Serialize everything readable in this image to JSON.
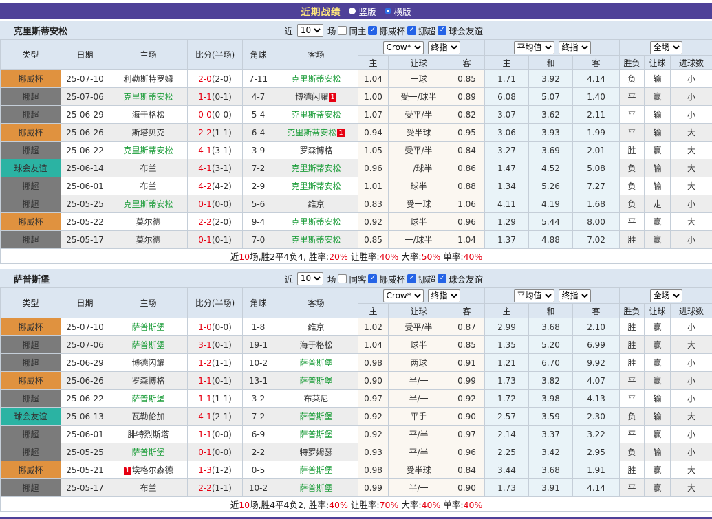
{
  "topbar": {
    "title": "近期战绩",
    "vertical": "竖版",
    "horizontal": "横版",
    "selected": "横版"
  },
  "filter": {
    "near": "近",
    "games": "场"
  },
  "table_header": {
    "type": "类型",
    "date": "日期",
    "home": "主场",
    "score": "比分(半场)",
    "corner": "角球",
    "away": "客场",
    "odds_selects": [
      "Crow*",
      "终指"
    ],
    "avg_selects": [
      "平均值",
      "终指"
    ],
    "result_selects": [
      "全场"
    ],
    "odds_cols": [
      "主",
      "让球",
      "客"
    ],
    "avg_cols": [
      "主",
      "和",
      "客"
    ],
    "result_cols": [
      "胜负",
      "让球",
      "进球数"
    ]
  },
  "colors": {
    "bar_purple": "#4e4198",
    "cup_orange": "#e0923f",
    "league_gray": "#7b7b7b",
    "friendly_teal": "#2bb3a3",
    "team_green": "#1f9e3c",
    "win_red": "#e60012",
    "lose_blue": "#4444cc",
    "draw_green": "#1f9e3c"
  },
  "sections": [
    {
      "team": "克里斯蒂安松",
      "filter_count": "10",
      "same_label": "同主",
      "same_checked": false,
      "leagues": [
        {
          "label": "挪威杯",
          "checked": true
        },
        {
          "label": "挪超",
          "checked": true
        },
        {
          "label": "球会友谊",
          "checked": true
        }
      ],
      "rows": [
        {
          "type": "挪威杯",
          "date": "25-07-10",
          "home": "利勒斯特罗姆",
          "home_green": false,
          "home_badge": "",
          "badge_before": false,
          "score": "2-0",
          "half": "(2-0)",
          "corner": "7-11",
          "away": "克里斯蒂安松",
          "away_green": true,
          "away_badge": "",
          "odds": [
            "1.04",
            "一球",
            "0.85"
          ],
          "avg": [
            "1.71",
            "3.92",
            "4.14"
          ],
          "result": [
            "负",
            "输",
            "小"
          ]
        },
        {
          "type": "挪超",
          "date": "25-07-06",
          "home": "克里斯蒂安松",
          "home_green": true,
          "home_badge": "",
          "badge_before": false,
          "score": "1-1",
          "half": "(0-1)",
          "corner": "4-7",
          "away": "博德闪耀",
          "away_green": false,
          "away_badge": "1",
          "odds": [
            "1.00",
            "受一/球半",
            "0.89"
          ],
          "avg": [
            "6.08",
            "5.07",
            "1.40"
          ],
          "result": [
            "平",
            "赢",
            "小"
          ]
        },
        {
          "type": "挪超",
          "date": "25-06-29",
          "home": "海于格松",
          "home_green": false,
          "home_badge": "",
          "badge_before": false,
          "score": "0-0",
          "half": "(0-0)",
          "corner": "5-4",
          "away": "克里斯蒂安松",
          "away_green": true,
          "away_badge": "",
          "odds": [
            "1.07",
            "受平/半",
            "0.82"
          ],
          "avg": [
            "3.07",
            "3.62",
            "2.11"
          ],
          "result": [
            "平",
            "输",
            "小"
          ]
        },
        {
          "type": "挪威杯",
          "date": "25-06-26",
          "home": "斯塔贝克",
          "home_green": false,
          "home_badge": "",
          "badge_before": false,
          "score": "2-2",
          "half": "(1-1)",
          "corner": "6-4",
          "away": "克里斯蒂安松",
          "away_green": true,
          "away_badge": "1",
          "odds": [
            "0.94",
            "受半球",
            "0.95"
          ],
          "avg": [
            "3.06",
            "3.93",
            "1.99"
          ],
          "result": [
            "平",
            "输",
            "大"
          ]
        },
        {
          "type": "挪超",
          "date": "25-06-22",
          "home": "克里斯蒂安松",
          "home_green": true,
          "home_badge": "",
          "badge_before": false,
          "score": "4-1",
          "half": "(3-1)",
          "corner": "3-9",
          "away": "罗森博格",
          "away_green": false,
          "away_badge": "",
          "odds": [
            "1.05",
            "受平/半",
            "0.84"
          ],
          "avg": [
            "3.27",
            "3.69",
            "2.01"
          ],
          "result": [
            "胜",
            "赢",
            "大"
          ]
        },
        {
          "type": "球会友谊",
          "date": "25-06-14",
          "home": "布兰",
          "home_green": false,
          "home_badge": "",
          "badge_before": false,
          "score": "4-1",
          "half": "(3-1)",
          "corner": "7-2",
          "away": "克里斯蒂安松",
          "away_green": true,
          "away_badge": "",
          "odds": [
            "0.96",
            "一/球半",
            "0.86"
          ],
          "avg": [
            "1.47",
            "4.52",
            "5.08"
          ],
          "result": [
            "负",
            "输",
            "大"
          ]
        },
        {
          "type": "挪超",
          "date": "25-06-01",
          "home": "布兰",
          "home_green": false,
          "home_badge": "",
          "badge_before": false,
          "score": "4-2",
          "half": "(4-2)",
          "corner": "2-9",
          "away": "克里斯蒂安松",
          "away_green": true,
          "away_badge": "",
          "odds": [
            "1.01",
            "球半",
            "0.88"
          ],
          "avg": [
            "1.34",
            "5.26",
            "7.27"
          ],
          "result": [
            "负",
            "输",
            "大"
          ]
        },
        {
          "type": "挪超",
          "date": "25-05-25",
          "home": "克里斯蒂安松",
          "home_green": true,
          "home_badge": "",
          "badge_before": false,
          "score": "0-1",
          "half": "(0-0)",
          "corner": "5-6",
          "away": "维京",
          "away_green": false,
          "away_badge": "",
          "odds": [
            "0.83",
            "受一球",
            "1.06"
          ],
          "avg": [
            "4.11",
            "4.19",
            "1.68"
          ],
          "result": [
            "负",
            "走",
            "小"
          ]
        },
        {
          "type": "挪威杯",
          "date": "25-05-22",
          "home": "莫尔德",
          "home_green": false,
          "home_badge": "",
          "badge_before": false,
          "score": "2-2",
          "half": "(2-0)",
          "corner": "9-4",
          "away": "克里斯蒂安松",
          "away_green": true,
          "away_badge": "",
          "odds": [
            "0.92",
            "球半",
            "0.96"
          ],
          "avg": [
            "1.29",
            "5.44",
            "8.00"
          ],
          "result": [
            "平",
            "赢",
            "大"
          ]
        },
        {
          "type": "挪超",
          "date": "25-05-17",
          "home": "莫尔德",
          "home_green": false,
          "home_badge": "",
          "badge_before": false,
          "score": "0-1",
          "half": "(0-1)",
          "corner": "7-0",
          "away": "克里斯蒂安松",
          "away_green": true,
          "away_badge": "",
          "odds": [
            "0.85",
            "一/球半",
            "1.04"
          ],
          "avg": [
            "1.37",
            "4.88",
            "7.02"
          ],
          "result": [
            "胜",
            "赢",
            "小"
          ]
        }
      ],
      "summary": [
        {
          "t": "近",
          "red": false
        },
        {
          "t": "10",
          "red": true
        },
        {
          "t": "场,胜2平4负4, 胜率:",
          "red": false
        },
        {
          "t": "20%",
          "red": true
        },
        {
          "t": " 让胜率:",
          "red": false
        },
        {
          "t": "40%",
          "red": true
        },
        {
          "t": " 大率:",
          "red": false
        },
        {
          "t": "50%",
          "red": true
        },
        {
          "t": " 单率:",
          "red": false
        },
        {
          "t": "40%",
          "red": true
        }
      ]
    },
    {
      "team": "萨普斯堡",
      "filter_count": "10",
      "same_label": "同客",
      "same_checked": false,
      "leagues": [
        {
          "label": "挪威杯",
          "checked": true
        },
        {
          "label": "挪超",
          "checked": true
        },
        {
          "label": "球会友谊",
          "checked": true
        }
      ],
      "rows": [
        {
          "type": "挪威杯",
          "date": "25-07-10",
          "home": "萨普斯堡",
          "home_green": true,
          "home_badge": "",
          "badge_before": false,
          "score": "1-0",
          "half": "(0-0)",
          "corner": "1-8",
          "away": "维京",
          "away_green": false,
          "away_badge": "",
          "odds": [
            "1.02",
            "受平/半",
            "0.87"
          ],
          "avg": [
            "2.99",
            "3.68",
            "2.10"
          ],
          "result": [
            "胜",
            "赢",
            "小"
          ]
        },
        {
          "type": "挪超",
          "date": "25-07-06",
          "home": "萨普斯堡",
          "home_green": true,
          "home_badge": "",
          "badge_before": false,
          "score": "3-1",
          "half": "(0-1)",
          "corner": "19-1",
          "away": "海于格松",
          "away_green": false,
          "away_badge": "",
          "odds": [
            "1.04",
            "球半",
            "0.85"
          ],
          "avg": [
            "1.35",
            "5.20",
            "6.99"
          ],
          "result": [
            "胜",
            "赢",
            "大"
          ]
        },
        {
          "type": "挪超",
          "date": "25-06-29",
          "home": "博德闪耀",
          "home_green": false,
          "home_badge": "",
          "badge_before": false,
          "score": "1-2",
          "half": "(1-1)",
          "corner": "10-2",
          "away": "萨普斯堡",
          "away_green": true,
          "away_badge": "",
          "odds": [
            "0.98",
            "两球",
            "0.91"
          ],
          "avg": [
            "1.21",
            "6.70",
            "9.92"
          ],
          "result": [
            "胜",
            "赢",
            "小"
          ]
        },
        {
          "type": "挪威杯",
          "date": "25-06-26",
          "home": "罗森博格",
          "home_green": false,
          "home_badge": "",
          "badge_before": false,
          "score": "1-1",
          "half": "(0-1)",
          "corner": "13-1",
          "away": "萨普斯堡",
          "away_green": true,
          "away_badge": "",
          "odds": [
            "0.90",
            "半/一",
            "0.99"
          ],
          "avg": [
            "1.73",
            "3.82",
            "4.07"
          ],
          "result": [
            "平",
            "赢",
            "小"
          ]
        },
        {
          "type": "挪超",
          "date": "25-06-22",
          "home": "萨普斯堡",
          "home_green": true,
          "home_badge": "",
          "badge_before": false,
          "score": "1-1",
          "half": "(1-1)",
          "corner": "3-2",
          "away": "布莱尼",
          "away_green": false,
          "away_badge": "",
          "odds": [
            "0.97",
            "半/一",
            "0.92"
          ],
          "avg": [
            "1.72",
            "3.98",
            "4.13"
          ],
          "result": [
            "平",
            "输",
            "小"
          ]
        },
        {
          "type": "球会友谊",
          "date": "25-06-13",
          "home": "瓦勒伦加",
          "home_green": false,
          "home_badge": "",
          "badge_before": false,
          "score": "4-1",
          "half": "(2-1)",
          "corner": "7-2",
          "away": "萨普斯堡",
          "away_green": true,
          "away_badge": "",
          "odds": [
            "0.92",
            "平手",
            "0.90"
          ],
          "avg": [
            "2.57",
            "3.59",
            "2.30"
          ],
          "result": [
            "负",
            "输",
            "大"
          ]
        },
        {
          "type": "挪超",
          "date": "25-06-01",
          "home": "腓特烈斯塔",
          "home_green": false,
          "home_badge": "",
          "badge_before": false,
          "score": "1-1",
          "half": "(0-0)",
          "corner": "6-9",
          "away": "萨普斯堡",
          "away_green": true,
          "away_badge": "",
          "odds": [
            "0.92",
            "平/半",
            "0.97"
          ],
          "avg": [
            "2.14",
            "3.37",
            "3.22"
          ],
          "result": [
            "平",
            "赢",
            "小"
          ]
        },
        {
          "type": "挪超",
          "date": "25-05-25",
          "home": "萨普斯堡",
          "home_green": true,
          "home_badge": "",
          "badge_before": false,
          "score": "0-1",
          "half": "(0-0)",
          "corner": "2-2",
          "away": "特罗姆瑟",
          "away_green": false,
          "away_badge": "",
          "odds": [
            "0.93",
            "平/半",
            "0.96"
          ],
          "avg": [
            "2.25",
            "3.42",
            "2.95"
          ],
          "result": [
            "负",
            "输",
            "小"
          ]
        },
        {
          "type": "挪威杯",
          "date": "25-05-21",
          "home": "埃格尔森德",
          "home_green": false,
          "home_badge": "1",
          "badge_before": true,
          "score": "1-3",
          "half": "(1-2)",
          "corner": "0-5",
          "away": "萨普斯堡",
          "away_green": true,
          "away_badge": "",
          "odds": [
            "0.98",
            "受半球",
            "0.84"
          ],
          "avg": [
            "3.44",
            "3.68",
            "1.91"
          ],
          "result": [
            "胜",
            "赢",
            "大"
          ]
        },
        {
          "type": "挪超",
          "date": "25-05-17",
          "home": "布兰",
          "home_green": false,
          "home_badge": "",
          "badge_before": false,
          "score": "2-2",
          "half": "(1-1)",
          "corner": "10-2",
          "away": "萨普斯堡",
          "away_green": true,
          "away_badge": "",
          "odds": [
            "0.99",
            "半/一",
            "0.90"
          ],
          "avg": [
            "1.73",
            "3.91",
            "4.14"
          ],
          "result": [
            "平",
            "赢",
            "大"
          ]
        }
      ],
      "summary": [
        {
          "t": "近",
          "red": false
        },
        {
          "t": "10",
          "red": true
        },
        {
          "t": "场,胜4平4负2, 胜率:",
          "red": false
        },
        {
          "t": "40%",
          "red": true
        },
        {
          "t": " 让胜率:",
          "red": false
        },
        {
          "t": "70%",
          "red": true
        },
        {
          "t": " 大率:",
          "red": false
        },
        {
          "t": "40%",
          "red": true
        },
        {
          "t": " 单率:",
          "red": false
        },
        {
          "t": "40%",
          "red": true
        }
      ]
    }
  ]
}
